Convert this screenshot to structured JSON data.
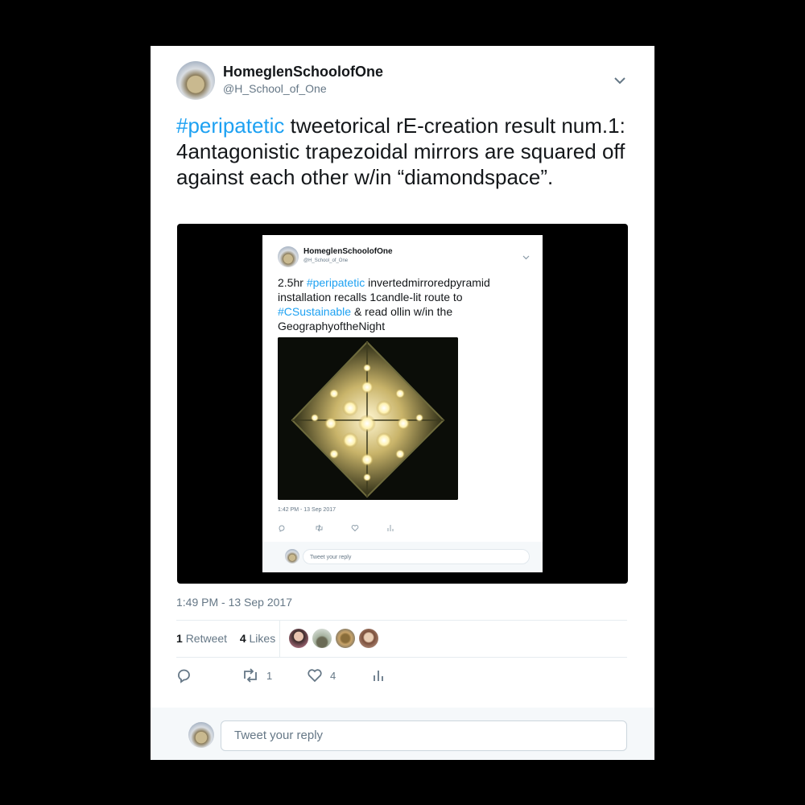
{
  "tweet": {
    "display_name": "HomeglenSchoolofOne",
    "handle": "@H_School_of_One",
    "hashtag": "#peripatetic",
    "text_rest": " tweetorical rE-creation result num.1: 4antagonistic trapezoidal mirrors are squared off against each other w/in “diamondspace”.",
    "timestamp": "1:49 PM - 13 Sep 2017",
    "retweet_count": "1",
    "retweet_label": "Retweet",
    "like_count": "4",
    "like_label": "Likes",
    "action_retweet_count": "1",
    "action_like_count": "4",
    "reply_placeholder": "Tweet your reply"
  },
  "embedded": {
    "display_name": "HomeglenSchoolofOne",
    "handle": "@H_School_of_One",
    "text_1": "2.5hr ",
    "hashtag_1": "#peripatetic",
    "text_2": " invertedmirroredpyramid installation recalls 1candle-lit route to ",
    "hashtag_2": "#CSustainable",
    "text_3": " & read ollin w/in the GeographyoftheNight",
    "timestamp": "1:42 PM - 13 Sep 2017",
    "reply_placeholder": "Tweet your reply"
  },
  "colors": {
    "link": "#1da1f2",
    "secondary_text": "#657786",
    "background": "#000000"
  },
  "icons": [
    "chevron-down-icon",
    "reply-icon",
    "retweet-icon",
    "heart-icon",
    "analytics-icon"
  ]
}
